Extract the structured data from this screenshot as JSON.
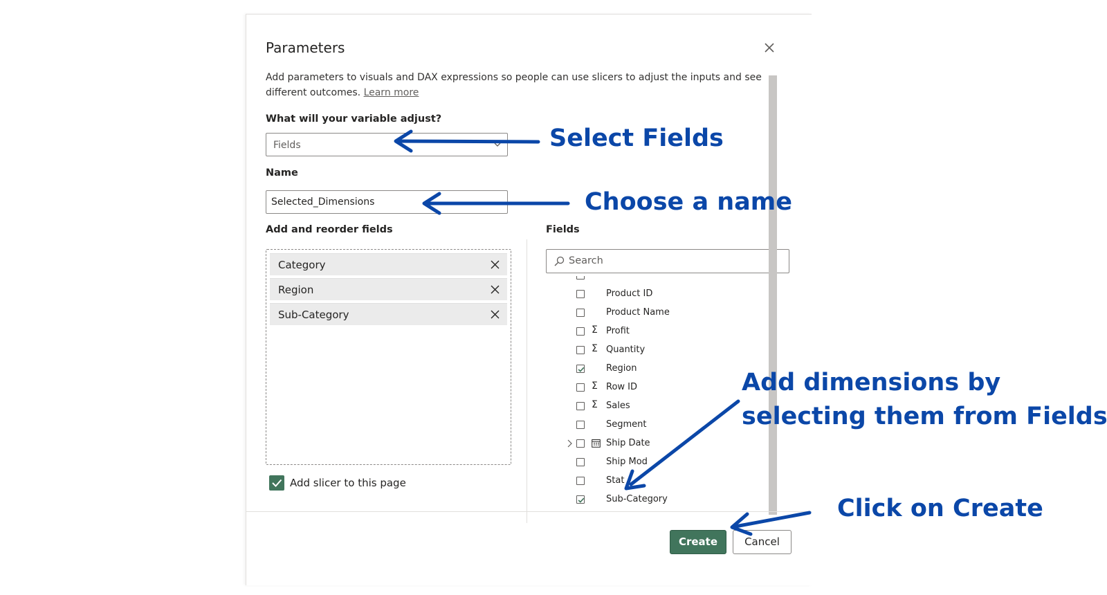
{
  "dialog": {
    "title": "Parameters",
    "description": "Add parameters to visuals and DAX expressions so people can use slicers to adjust the inputs and see different outcomes.",
    "learn_more": "Learn more",
    "variable_label": "What will your variable adjust?",
    "variable_value": "Fields",
    "name_label": "Name",
    "name_value": "Selected_Dimensions",
    "reorder_label": "Add and reorder fields",
    "selected_fields": [
      "Category",
      "Region",
      "Sub-Category"
    ],
    "fields_label": "Fields",
    "search_placeholder": "Search",
    "field_list": [
      {
        "label": "Product ID",
        "checked": false,
        "icon": ""
      },
      {
        "label": "Product Name",
        "checked": false,
        "icon": ""
      },
      {
        "label": "Profit",
        "checked": false,
        "icon": "sigma-icon"
      },
      {
        "label": "Quantity",
        "checked": false,
        "icon": "sigma-icon"
      },
      {
        "label": "Region",
        "checked": true,
        "icon": ""
      },
      {
        "label": "Row ID",
        "checked": false,
        "icon": "sigma-icon"
      },
      {
        "label": "Sales",
        "checked": false,
        "icon": "sigma-icon"
      },
      {
        "label": "Segment",
        "checked": false,
        "icon": ""
      },
      {
        "label": "Ship Date",
        "checked": false,
        "icon": "calendar-icon",
        "expandable": true
      },
      {
        "label": "Ship Mod",
        "checked": false,
        "icon": ""
      },
      {
        "label": "Stat",
        "checked": false,
        "icon": ""
      },
      {
        "label": "Sub-Category",
        "checked": true,
        "icon": ""
      }
    ],
    "slicer_label": "Add slicer to this page",
    "slicer_checked": true,
    "create_label": "Create",
    "cancel_label": "Cancel"
  },
  "annotations": {
    "select_fields": "Select Fields",
    "choose_name": "Choose a name",
    "add_dimensions_line1": "Add dimensions by",
    "add_dimensions_line2": "selecting them from Fields",
    "click_create": "Click on Create"
  },
  "colors": {
    "accent_green": "#41755c",
    "annotation_blue": "#0b47a8"
  }
}
